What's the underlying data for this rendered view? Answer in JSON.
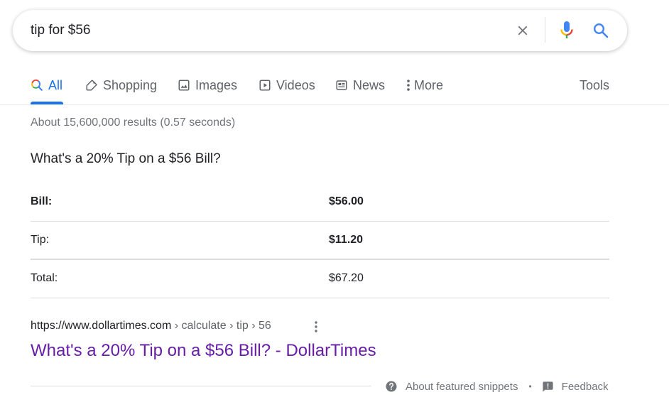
{
  "search": {
    "query": "tip for $56",
    "clear_icon": "close-icon",
    "voice_icon": "microphone-icon",
    "submit_icon": "search-icon"
  },
  "tabs": [
    {
      "label": "All",
      "icon": "search-icon",
      "active": true
    },
    {
      "label": "Shopping",
      "icon": "tag-icon",
      "active": false
    },
    {
      "label": "Images",
      "icon": "image-icon",
      "active": false
    },
    {
      "label": "Videos",
      "icon": "play-icon",
      "active": false
    },
    {
      "label": "News",
      "icon": "newspaper-icon",
      "active": false
    },
    {
      "label": "More",
      "icon": "more-vertical-icon",
      "active": false
    }
  ],
  "tools_label": "Tools",
  "result_stats": "About 15,600,000 results (0.57 seconds)",
  "snippet": {
    "heading": "What's a 20% Tip on a $56 Bill?",
    "rows": [
      {
        "label": "Bill:",
        "value": "$56.00"
      },
      {
        "label": "Tip:",
        "value": "$11.20"
      },
      {
        "label": "Total:",
        "value": "$67.20"
      }
    ]
  },
  "result": {
    "url_base": "https://www.dollartimes.com",
    "url_crumbs": " › calculate › tip › 56",
    "title": "What's a 20% Tip on a $56 Bill? - DollarTimes"
  },
  "footer": {
    "about_label": "About featured snippets",
    "separator": "•",
    "feedback_label": "Feedback"
  },
  "colors": {
    "accent": "#1a73e8",
    "visited_link": "#681da8",
    "muted_text": "#70757a"
  }
}
